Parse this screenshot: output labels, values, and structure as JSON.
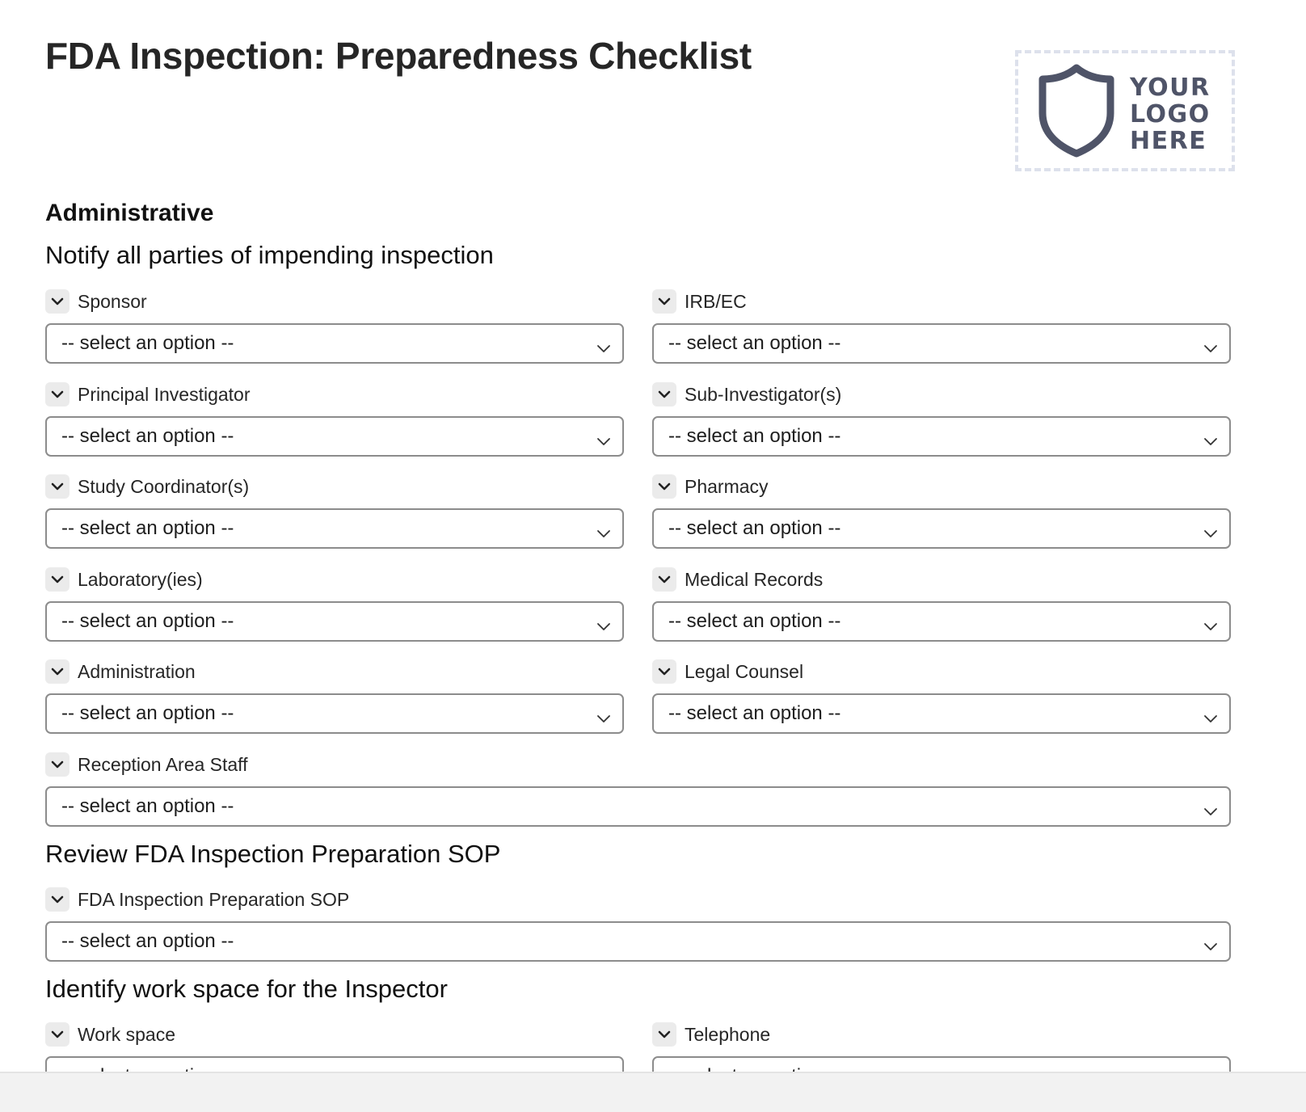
{
  "header": {
    "title": "FDA Inspection: Preparedness Checklist",
    "logo": {
      "icon": "shield-icon",
      "lines": [
        "YOUR",
        "LOGO",
        "HERE"
      ]
    }
  },
  "sections": {
    "administrative": {
      "heading": "Administrative",
      "notify": {
        "heading": "Notify all parties of impending inspection",
        "fields": [
          {
            "label": "Sponsor",
            "value": "-- select an option --"
          },
          {
            "label": "IRB/EC",
            "value": "-- select an option --"
          },
          {
            "label": "Principal Investigator",
            "value": "-- select an option --"
          },
          {
            "label": "Sub-Investigator(s)",
            "value": "-- select an option --"
          },
          {
            "label": "Study Coordinator(s)",
            "value": "-- select an option --"
          },
          {
            "label": "Pharmacy",
            "value": "-- select an option --"
          },
          {
            "label": "Laboratory(ies)",
            "value": "-- select an option --"
          },
          {
            "label": "Medical Records",
            "value": "-- select an option --"
          },
          {
            "label": "Administration",
            "value": "-- select an option --"
          },
          {
            "label": "Legal Counsel",
            "value": "-- select an option --"
          },
          {
            "label": "Reception Area Staff",
            "value": "-- select an option --"
          }
        ]
      },
      "review": {
        "heading": "Review FDA Inspection Preparation SOP",
        "fields": [
          {
            "label": "FDA Inspection Preparation SOP",
            "value": "-- select an option --"
          }
        ]
      },
      "workspace": {
        "heading": "Identify work space for the Inspector",
        "fields": [
          {
            "label": "Work space",
            "value": "-- select an option --"
          },
          {
            "label": "Telephone",
            "value": "-- select an option --"
          }
        ]
      }
    }
  }
}
